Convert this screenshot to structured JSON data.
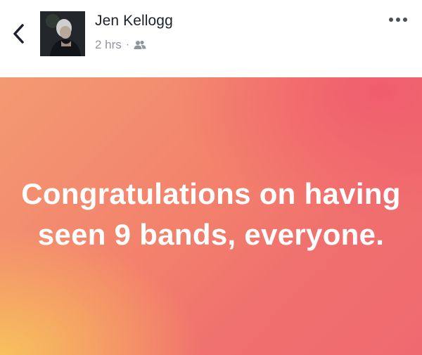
{
  "header": {
    "back_icon": "chevron-left-icon",
    "author_name": "Jen Kellogg",
    "timestamp": "2 hrs",
    "separator": "·",
    "audience_icon": "friends-icon",
    "more_icon": "more-options-icon"
  },
  "post": {
    "text": "Congratulations on having seen 9 bands, everyone.",
    "background_colors": [
      "#f8c45c",
      "#f39a72",
      "#f0706e",
      "#ef6a70"
    ],
    "text_color": "#ffffff"
  }
}
